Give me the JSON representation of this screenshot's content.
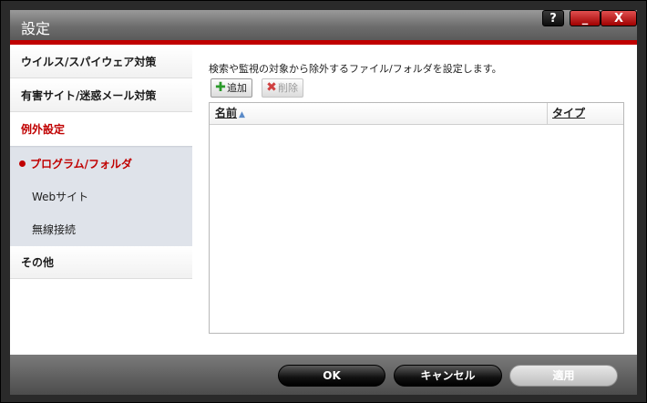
{
  "window": {
    "title": "設定",
    "help_label": "?",
    "minimize_label": "_",
    "close_label": "X"
  },
  "sidebar": {
    "items": [
      {
        "label": "ウイルス/スパイウェア対策"
      },
      {
        "label": "有害サイト/迷惑メール対策"
      },
      {
        "label": "例外設定"
      },
      {
        "label": "プログラム/フォルダ"
      },
      {
        "label": "Webサイト"
      },
      {
        "label": "無線接続"
      },
      {
        "label": "その他"
      }
    ]
  },
  "main": {
    "description": "検索や監視の対象から除外するファイル/フォルダを設定します。",
    "add_label": "追加",
    "delete_label": "削除",
    "table": {
      "columns": [
        "名前",
        "タイプ"
      ],
      "rows": []
    }
  },
  "footer": {
    "ok_label": "OK",
    "cancel_label": "キャンセル",
    "apply_label": "適用"
  },
  "colors": {
    "accent": "#c00000"
  }
}
